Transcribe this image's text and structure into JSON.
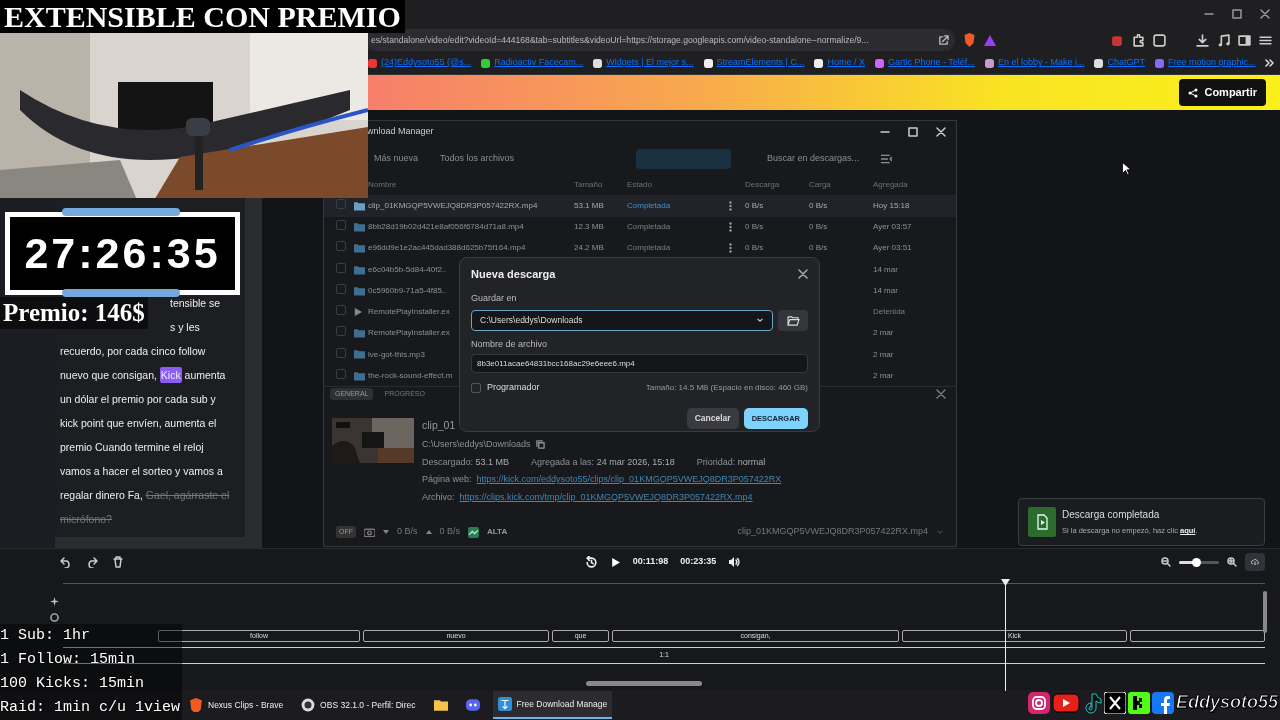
{
  "stream_overlay": {
    "title": "EXTENSIBLE CON PREMIO",
    "webcam": {
      "kind": "picture"
    },
    "timer": "27:26:35",
    "prize": "Premio: 146$",
    "rules": [
      "1 Sub: 1hr",
      "1 Follow: 15min",
      "100 Kicks: 15min",
      "Raid: 1min c/u 1view"
    ],
    "channel": "Eddysoto55"
  },
  "browser": {
    "address": "es/standalone/video/edit?videoId=444168&tab=subtitles&videoUrl=https://storage.googleapis.com/video-standalone--normalize/9...",
    "bookmarks": [
      "(24)Eddysoto55 (@s...",
      "Radioactiv Facecam...",
      "Widgets | El mejor s...",
      "StreamElements | C...",
      "Home / X",
      "Gartic Phone - Teléf...",
      "En el lobby - Make i...",
      "ChatGPT",
      "Free motion graphic..."
    ],
    "share_button": "Compartir"
  },
  "subtitles": {
    "lines": [
      {
        "segments": [
          {
            "kind": "cut",
            "text": "tensible se"
          }
        ]
      },
      {
        "segments": [
          {
            "kind": "cut",
            "text": "s y les"
          }
        ]
      },
      {
        "segments": [
          {
            "kind": "plain",
            "text": "recuerdo, por cada cinco follow"
          }
        ]
      },
      {
        "segments": [
          {
            "kind": "plain",
            "text": "nuevo que consigan, "
          },
          {
            "kind": "highlight",
            "text": "Kick"
          },
          {
            "kind": "plain",
            "text": " aumenta"
          }
        ]
      },
      {
        "segments": [
          {
            "kind": "plain",
            "text": "un dólar el premio por cada sub  y"
          }
        ]
      },
      {
        "segments": [
          {
            "kind": "plain",
            "text": "kick point que envíen, aumenta el"
          }
        ]
      },
      {
        "segments": [
          {
            "kind": "plain",
            "text": "premio Cuando termine el reloj"
          }
        ]
      },
      {
        "segments": [
          {
            "kind": "plain",
            "text": "vamos a hacer el sorteo y vamos a"
          }
        ]
      },
      {
        "segments": [
          {
            "kind": "plain",
            "text": "regalar dinero Fa, "
          },
          {
            "kind": "struck",
            "text": "Gael, agárraste el"
          }
        ]
      },
      {
        "segments": [
          {
            "kind": "struck",
            "text": "micrófono?"
          }
        ]
      }
    ]
  },
  "download_manager": {
    "title": "wnload Manager",
    "sort": "Más nueva",
    "filter": "Todos los archivos",
    "search": {
      "placeholder": "Buscar en descargas..."
    },
    "columns": [
      "Nombre",
      "Tamaño",
      "Estado",
      "Descarga",
      "Carga",
      "Agregada"
    ],
    "rows": [
      {
        "kind": "file",
        "selected": true,
        "name": "clip_01KMGQP5VWEJQ8DR3P057422RX.mp4",
        "size": "53.1 MB",
        "status": "Completada",
        "down": "0 B/s",
        "up": "0 B/s",
        "added": "Hoy 15:18"
      },
      {
        "kind": "file",
        "selected": false,
        "name": "8bb28d19b02d421e8af056f6784d71a8.mp4",
        "size": "12.3 MB",
        "status": "Completada",
        "down": "0 B/s",
        "up": "0 B/s",
        "added": "Ayer 03:57"
      },
      {
        "kind": "file",
        "selected": false,
        "name": "e96dd9e1e2ac445dad388d625b75f164.mp4",
        "size": "24.2 MB",
        "status": "Completada",
        "down": "0 B/s",
        "up": "0 B/s",
        "added": "Ayer 03:51"
      },
      {
        "kind": "file",
        "selected": false,
        "name": "e6c04b5b-5d84-40f2..",
        "added": "14 mar"
      },
      {
        "kind": "file",
        "selected": false,
        "name": "0c5960b9-71a5-4f85..",
        "added": "14 mar"
      },
      {
        "kind": "paused",
        "selected": false,
        "name": "RemotePlayInstaller.ex",
        "added": "Detenida"
      },
      {
        "kind": "file",
        "selected": false,
        "name": "RemotePlayInstaller.ex",
        "added": "2 mar"
      },
      {
        "kind": "file",
        "selected": false,
        "name": "lve-got-this.mp3",
        "added": "2 mar"
      },
      {
        "kind": "file",
        "selected": false,
        "name": "the-rock-sound-effect.m",
        "added": "2 mar"
      }
    ],
    "tabs": [
      {
        "label": "GENERAL",
        "selected": true
      },
      {
        "label": "PROGRESO",
        "selected": false
      }
    ],
    "details": {
      "name": "clip_01",
      "path": "C:\\Users\\eddys\\Downloads",
      "fields": [
        {
          "label": "Descargado:",
          "value": "53.1 MB"
        },
        {
          "label": "Agregada a las:",
          "value": "24 mar 2026, 15:18"
        },
        {
          "label": "Prioridad:",
          "value": "normal"
        }
      ],
      "links": [
        {
          "label": "Página web:",
          "url": "https://kick.com/eddysoto55/clips/clip_01KMGQP5VWEJQ8DR3P057422RX"
        },
        {
          "label": "Archivo:",
          "url": "https://clips.kick.com/tmp/clip_01KMGQP5VWEJQ8DR3P057422RX.mp4"
        }
      ]
    },
    "status_bar": {
      "toggle": {
        "label": "OFF",
        "on": false
      },
      "down": "0 B/s",
      "up": "0 B/s",
      "priority": "ALTA",
      "file": "clip_01KMGQP5VWEJQ8DR3P057422RX.mp4"
    }
  },
  "dialog": {
    "title": "Nueva descarga",
    "save_label": "Guardar en",
    "save_path": "C:\\Users\\eddys\\Downloads",
    "name_label": "Nombre de archivo",
    "file_name": "8b3e011acae64831bcc168ac29e6eee6.mp4",
    "scheduler": {
      "label": "Programador",
      "checked": false
    },
    "size": "Tamaño: 14.5 MB (Espacio en disco: 460 GB)",
    "cancel": "Cancelar",
    "confirm": "DESCARGAR"
  },
  "toast": {
    "title": "Descarga completada",
    "message": "Si la descarga no empezó, haz clic",
    "link": "aquí",
    "after": "."
  },
  "timeline": {
    "current": "00:11:98",
    "total": "00:23:35",
    "zoom": {
      "level": 0.42
    },
    "captions": [
      "follow",
      "nuevo",
      "que",
      "consigan,",
      "Kick"
    ],
    "marker": "1:1"
  },
  "taskbar": [
    {
      "kind": "brave",
      "label": "Nexus Clips - Brave",
      "active": false
    },
    {
      "kind": "obs",
      "label": "OBS 32.1.0 - Perfil: Direc",
      "active": false
    },
    {
      "kind": "folder",
      "active": false
    },
    {
      "kind": "discord",
      "active": false
    },
    {
      "kind": "fdm",
      "label": "Free Download Manage",
      "active": true
    }
  ]
}
